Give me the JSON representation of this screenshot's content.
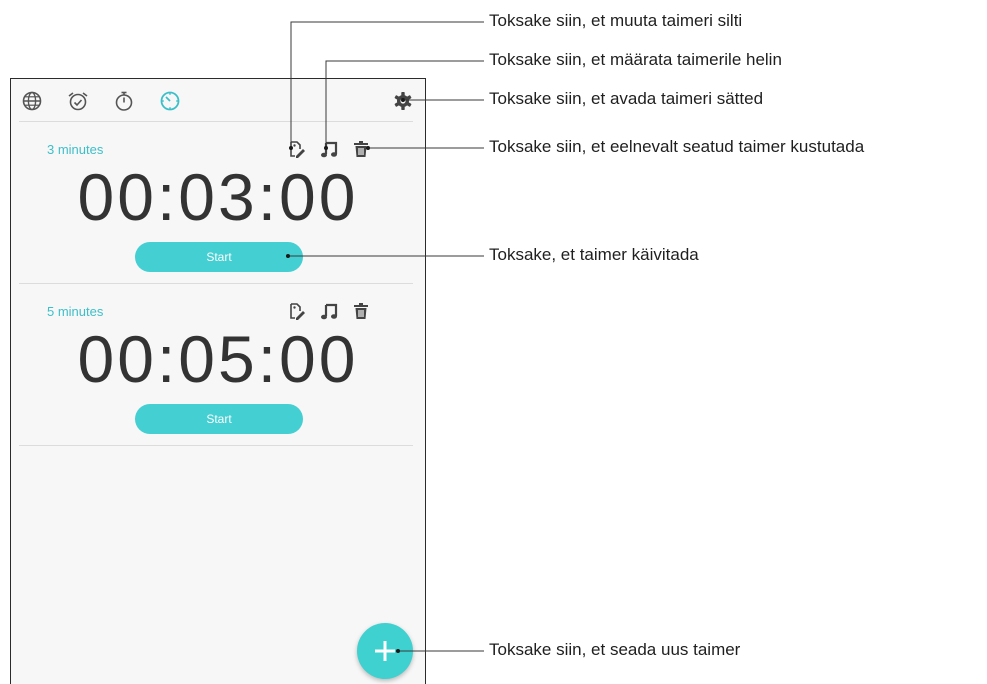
{
  "tabs": [
    {
      "name": "world-clock",
      "icon": "globe-icon"
    },
    {
      "name": "alarm",
      "icon": "alarm-clock-icon"
    },
    {
      "name": "stopwatch",
      "icon": "stopwatch-icon"
    },
    {
      "name": "timer",
      "icon": "timer-icon",
      "active": true
    }
  ],
  "settings_icon": "gear-icon",
  "timers": [
    {
      "label": "3 minutes",
      "time": "00:03:00",
      "start_label": "Start"
    },
    {
      "label": "5 minutes",
      "time": "00:05:00",
      "start_label": "Start"
    }
  ],
  "fab_icon": "plus-icon",
  "callouts": [
    "Toksake siin, et muuta taimeri silti",
    "Toksake siin, et määrata taimerile helin",
    "Toksake siin, et avada taimeri sätted",
    "Toksake siin, et eelnevalt seatud taimer kustutada",
    "Toksake, et taimer käivitada",
    "Toksake siin, et seada uus taimer"
  ],
  "colors": {
    "accent": "#3dbfc9",
    "button": "#44cfd2",
    "fab": "#3fd0d0"
  }
}
